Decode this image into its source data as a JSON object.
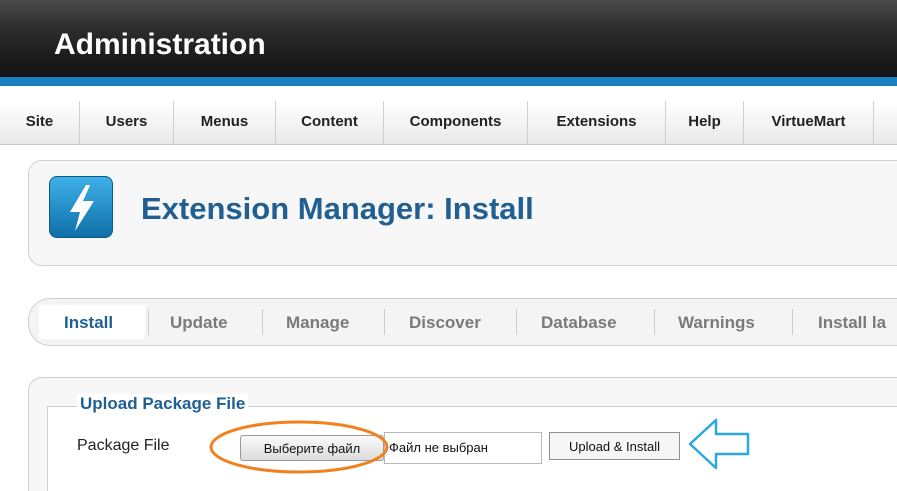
{
  "header": {
    "title": "Administration"
  },
  "menu": {
    "items": [
      "Site",
      "Users",
      "Menus",
      "Content",
      "Components",
      "Extensions",
      "Help",
      "VirtueMart"
    ]
  },
  "page": {
    "title": "Extension Manager: Install",
    "icon": "lightning-icon"
  },
  "tabs": {
    "items": [
      "Install",
      "Update",
      "Manage",
      "Discover",
      "Database",
      "Warnings",
      "Install la"
    ],
    "active": "Install"
  },
  "upload": {
    "legend": "Upload Package File",
    "label": "Package File",
    "choose_button": "Выберите файл",
    "file_status": "Файл не выбран",
    "install_button": "Upload & Install"
  },
  "colors": {
    "header_bg": "#1a1a1a",
    "header_accent": "#1c7fc2",
    "title_blue": "#1f5f92",
    "annotation_orange": "#f0821e",
    "annotation_blue": "#2aa8e6"
  }
}
